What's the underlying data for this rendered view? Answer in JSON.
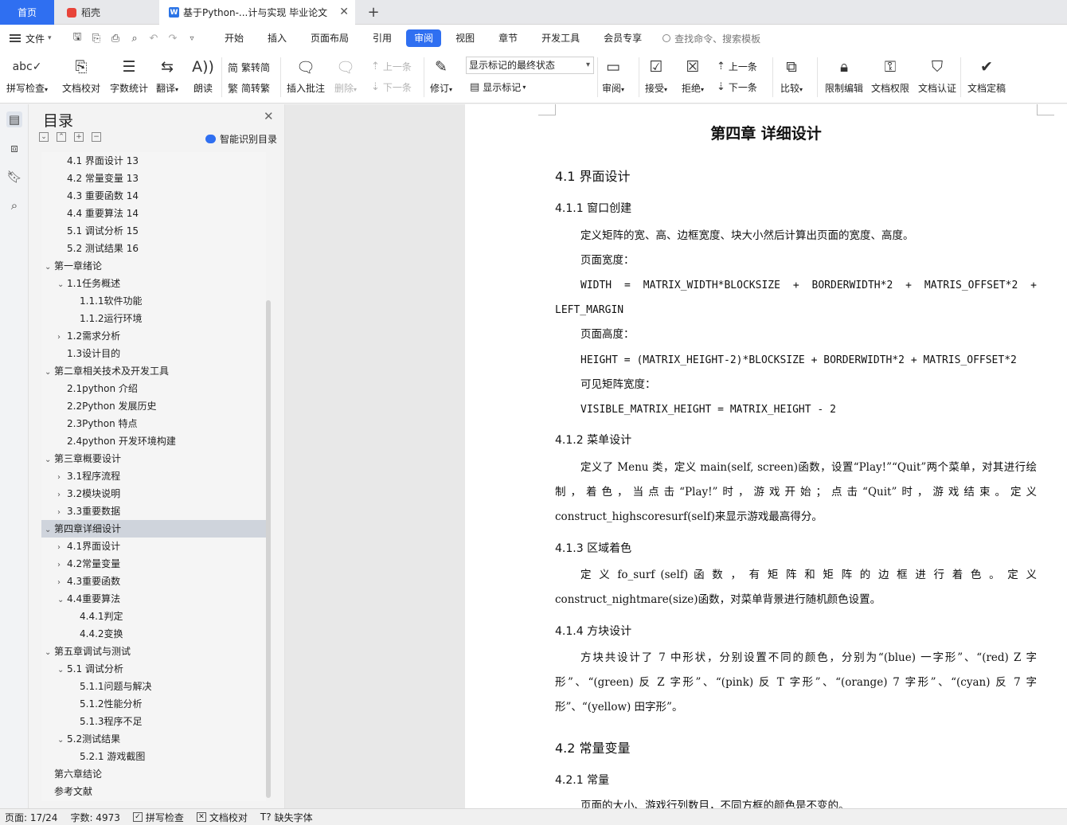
{
  "tabs": {
    "home": "首页",
    "daoke": "稻壳",
    "doc": "基于Python-...计与实现 毕业论文",
    "add": "+"
  },
  "menu": {
    "file": "文件",
    "items": [
      "开始",
      "插入",
      "页面布局",
      "引用",
      "审阅",
      "视图",
      "章节",
      "开发工具",
      "会员专享"
    ],
    "active": "审阅",
    "search": "查找命令、搜索模板"
  },
  "ribbon": {
    "spell": "拼写检查",
    "proof": "文档校对",
    "wordcount": "字数统计",
    "translate": "翻译",
    "read": "朗读",
    "trad": "繁转简",
    "simp": "简转繁",
    "insert_comment": "插入批注",
    "delete": "删除",
    "prev_comment": "上一条",
    "next_comment": "下一条",
    "revise": "修订",
    "markup_select": "显示标记的最终状态",
    "show_markup": "显示标记",
    "review": "审阅",
    "accept": "接受",
    "reject": "拒绝",
    "prev_change": "上一条",
    "next_change": "下一条",
    "compare": "比较",
    "restrict": "限制编辑",
    "permission": "文档权限",
    "certify": "文档认证",
    "finalize": "文档定稿"
  },
  "toc": {
    "title": "目录",
    "smart": "智能识别目录",
    "items": [
      {
        "text": "4.1  界面设计  13",
        "level": 2,
        "arrow": ""
      },
      {
        "text": "4.2  常量变量  13",
        "level": 2,
        "arrow": ""
      },
      {
        "text": "4.3  重要函数  14",
        "level": 2,
        "arrow": ""
      },
      {
        "text": "4.4  重要算法  14",
        "level": 2,
        "arrow": ""
      },
      {
        "text": "5.1  调试分析  15",
        "level": 2,
        "arrow": ""
      },
      {
        "text": "5.2  测试结果  16",
        "level": 2,
        "arrow": ""
      },
      {
        "text": "第一章绪论",
        "level": 1,
        "arrow": "v"
      },
      {
        "text": "1.1任务概述",
        "level": 2,
        "arrow": "v"
      },
      {
        "text": "1.1.1软件功能",
        "level": 3,
        "arrow": ""
      },
      {
        "text": "1.1.2运行环境",
        "level": 3,
        "arrow": ""
      },
      {
        "text": "1.2需求分析",
        "level": 2,
        "arrow": ">"
      },
      {
        "text": "1.3设计目的",
        "level": 2,
        "arrow": ""
      },
      {
        "text": "第二章相关技术及开发工具",
        "level": 1,
        "arrow": "v"
      },
      {
        "text": "2.1python 介绍",
        "level": 2,
        "arrow": ""
      },
      {
        "text": "2.2Python  发展历史",
        "level": 2,
        "arrow": ""
      },
      {
        "text": "2.3Python  特点",
        "level": 2,
        "arrow": ""
      },
      {
        "text": "2.4python 开发环境构建",
        "level": 2,
        "arrow": ""
      },
      {
        "text": "第三章概要设计",
        "level": 1,
        "arrow": "v"
      },
      {
        "text": "3.1程序流程",
        "level": 2,
        "arrow": ">"
      },
      {
        "text": "3.2模块说明",
        "level": 2,
        "arrow": ">"
      },
      {
        "text": "3.3重要数据",
        "level": 2,
        "arrow": ">"
      },
      {
        "text": "第四章详细设计",
        "level": 1,
        "arrow": "v",
        "highlight": true
      },
      {
        "text": "4.1界面设计",
        "level": 2,
        "arrow": ">"
      },
      {
        "text": "4.2常量变量",
        "level": 2,
        "arrow": ">"
      },
      {
        "text": "4.3重要函数",
        "level": 2,
        "arrow": ">"
      },
      {
        "text": "4.4重要算法",
        "level": 2,
        "arrow": "v"
      },
      {
        "text": "4.4.1判定",
        "level": 3,
        "arrow": ""
      },
      {
        "text": "4.4.2变换",
        "level": 3,
        "arrow": ""
      },
      {
        "text": "第五章调试与测试",
        "level": 1,
        "arrow": "v"
      },
      {
        "text": "5.1 调试分析",
        "level": 2,
        "arrow": "v"
      },
      {
        "text": "5.1.1问题与解决",
        "level": 3,
        "arrow": ""
      },
      {
        "text": "5.1.2性能分析",
        "level": 3,
        "arrow": ""
      },
      {
        "text": "5.1.3程序不足",
        "level": 3,
        "arrow": ""
      },
      {
        "text": "5.2测试结果",
        "level": 2,
        "arrow": "v"
      },
      {
        "text": "5.2.1 游戏截图",
        "level": 3,
        "arrow": ""
      },
      {
        "text": "第六章结论",
        "level": 1,
        "arrow": ""
      },
      {
        "text": "参考文献",
        "level": 1,
        "arrow": ""
      }
    ]
  },
  "doc": {
    "chapter": "第四章  详细设计",
    "s41": "4.1  界面设计",
    "s411": "4.1.1  窗口创建",
    "p1": "定义矩阵的宽、高、边框宽度、块大小然后计算出页面的宽度、高度。",
    "p2": "页面宽度：",
    "code1": "WIDTH  =  MATRIX_WIDTH*BLOCKSIZE  +  BORDERWIDTH*2  +  MATRIS_OFFSET*2  + LEFT_MARGIN",
    "p3": "页面高度：",
    "code2": "HEIGHT = (MATRIX_HEIGHT-2)*BLOCKSIZE + BORDERWIDTH*2 + MATRIS_OFFSET*2",
    "p4": "可见矩阵宽度：",
    "code3": "VISIBLE_MATRIX_HEIGHT = MATRIX_HEIGHT - 2",
    "s412": "4.1.2  菜单设计",
    "p5": "定义了 Menu 类，定义 main(self, screen)函数，设置“Play!”“Quit”两个菜单，对其进行绘制，着色，当点击“Play!”时，游戏开始；点击“Quit”时，游戏结束。定义 construct_highscoresurf(self)来显示游戏最高得分。",
    "s413": "4.1.3   区域着色",
    "p6": "定 义  fo_surf  (self) 函 数 ， 有 矩 阵 和 矩 阵 的 边 框 进 行 着 色 。 定 义 construct_nightmare(size)函数，对菜单背景进行随机颜色设置。",
    "s414": "4.1.4  方块设计",
    "p7": "方块共设计了 7 中形状，分别设置不同的颜色，分别为“(blue) 一字形”、“(red) Z 字形”、“(green) 反 Z 字形”、“(pink) 反 T 字形”、“(orange) 7 字形”、“(cyan) 反 7 字形”、“(yellow) 田字形”。",
    "s42": "4.2  常量变量",
    "s421": "4.2.1  常量",
    "p8": "页面的大小、游戏行列数目，不同方框的颜色是不变的。"
  },
  "status": {
    "page": "页面: 17/24",
    "words": "字数: 4973",
    "spell": "拼写检查",
    "proof": "文档校对",
    "font": "缺失字体"
  }
}
